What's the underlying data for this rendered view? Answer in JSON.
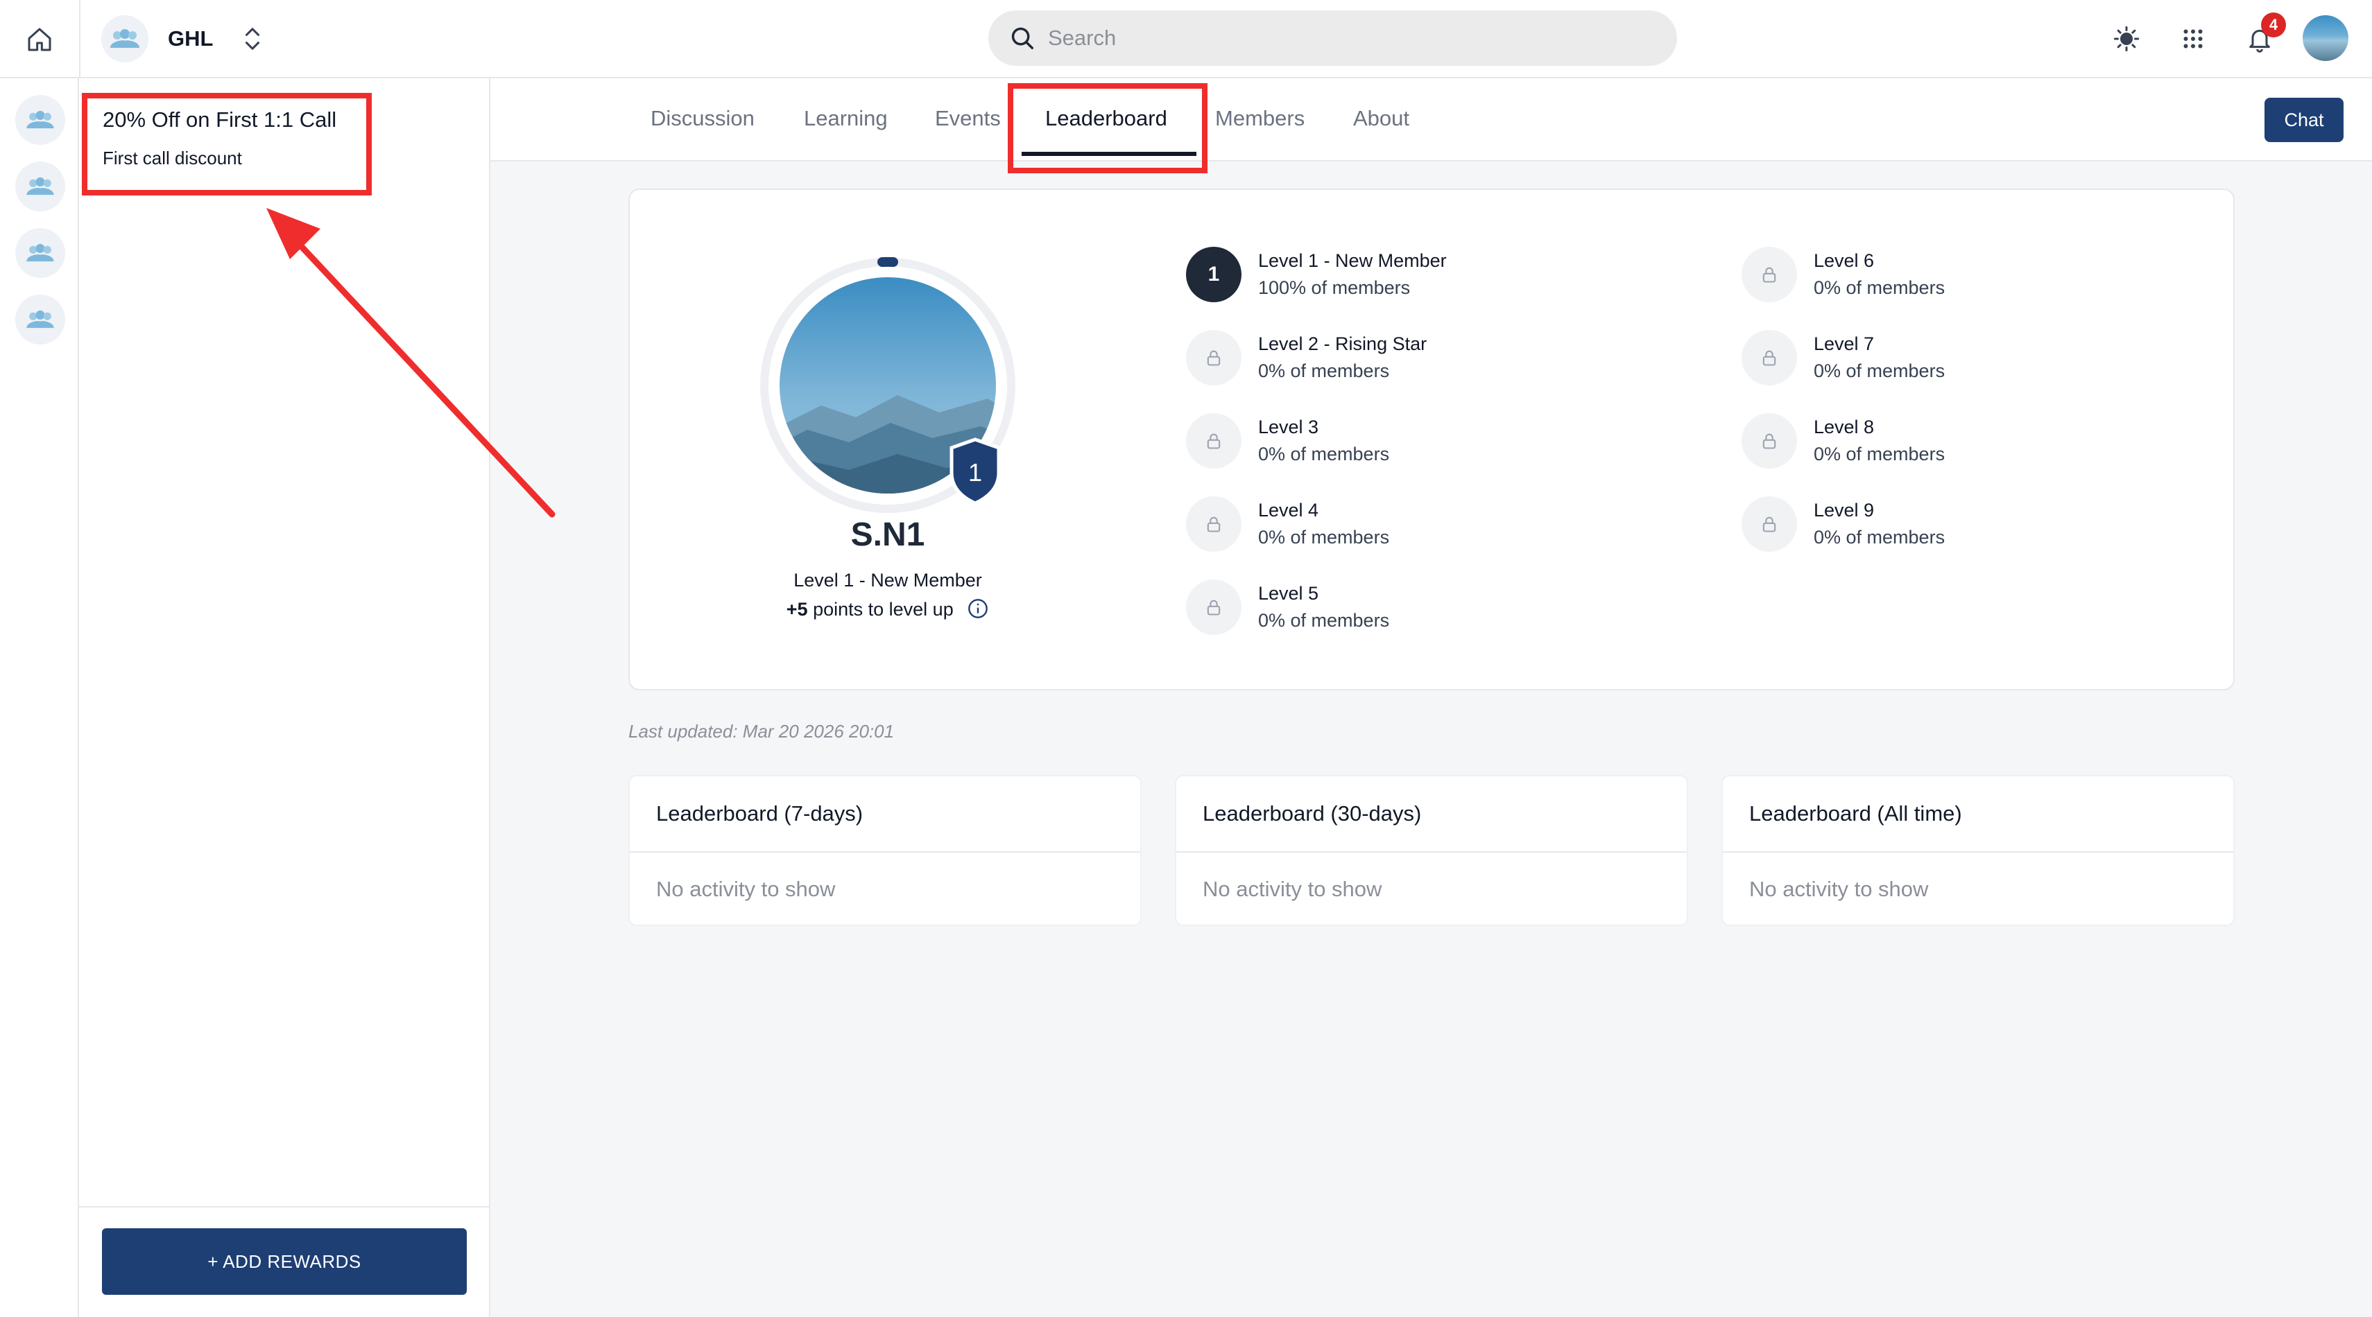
{
  "topbar": {
    "group_name": "GHL",
    "search_placeholder": "Search",
    "notification_count": "4"
  },
  "rewards": {
    "title": "20% Off on First 1:1 Call",
    "subtitle": "First call discount",
    "add_button": "+ ADD REWARDS"
  },
  "tabs": {
    "items": [
      "Discussion",
      "Learning",
      "Events",
      "Leaderboard",
      "Members",
      "About"
    ],
    "active": "Leaderboard",
    "chat_button": "Chat"
  },
  "profile": {
    "name": "S.N1",
    "level_badge": "1",
    "level_label": "Level 1 - New Member",
    "points_value": "+5",
    "points_text": "points to level up"
  },
  "levels": [
    {
      "badge": "1",
      "name": "Level 1 - New Member",
      "percent": "100% of members",
      "locked": false
    },
    {
      "badge": "",
      "name": "Level 2 - Rising Star",
      "percent": "0% of members",
      "locked": true
    },
    {
      "badge": "",
      "name": "Level 3",
      "percent": "0% of members",
      "locked": true
    },
    {
      "badge": "",
      "name": "Level 4",
      "percent": "0% of members",
      "locked": true
    },
    {
      "badge": "",
      "name": "Level 5",
      "percent": "0% of members",
      "locked": true
    },
    {
      "badge": "",
      "name": "Level 6",
      "percent": "0% of members",
      "locked": true
    },
    {
      "badge": "",
      "name": "Level 7",
      "percent": "0% of members",
      "locked": true
    },
    {
      "badge": "",
      "name": "Level 8",
      "percent": "0% of members",
      "locked": true
    },
    {
      "badge": "",
      "name": "Level 9",
      "percent": "0% of members",
      "locked": true
    }
  ],
  "last_updated": "Last updated: Mar 20 2026 20:01",
  "leaderboards": [
    {
      "title": "Leaderboard (7-days)",
      "empty": "No activity to show"
    },
    {
      "title": "Leaderboard (30-days)",
      "empty": "No activity to show"
    },
    {
      "title": "Leaderboard (All time)",
      "empty": "No activity to show"
    }
  ],
  "colors": {
    "primary": "#1e3f74",
    "annotation": "#ef2d2d",
    "notification": "#dc2626"
  }
}
